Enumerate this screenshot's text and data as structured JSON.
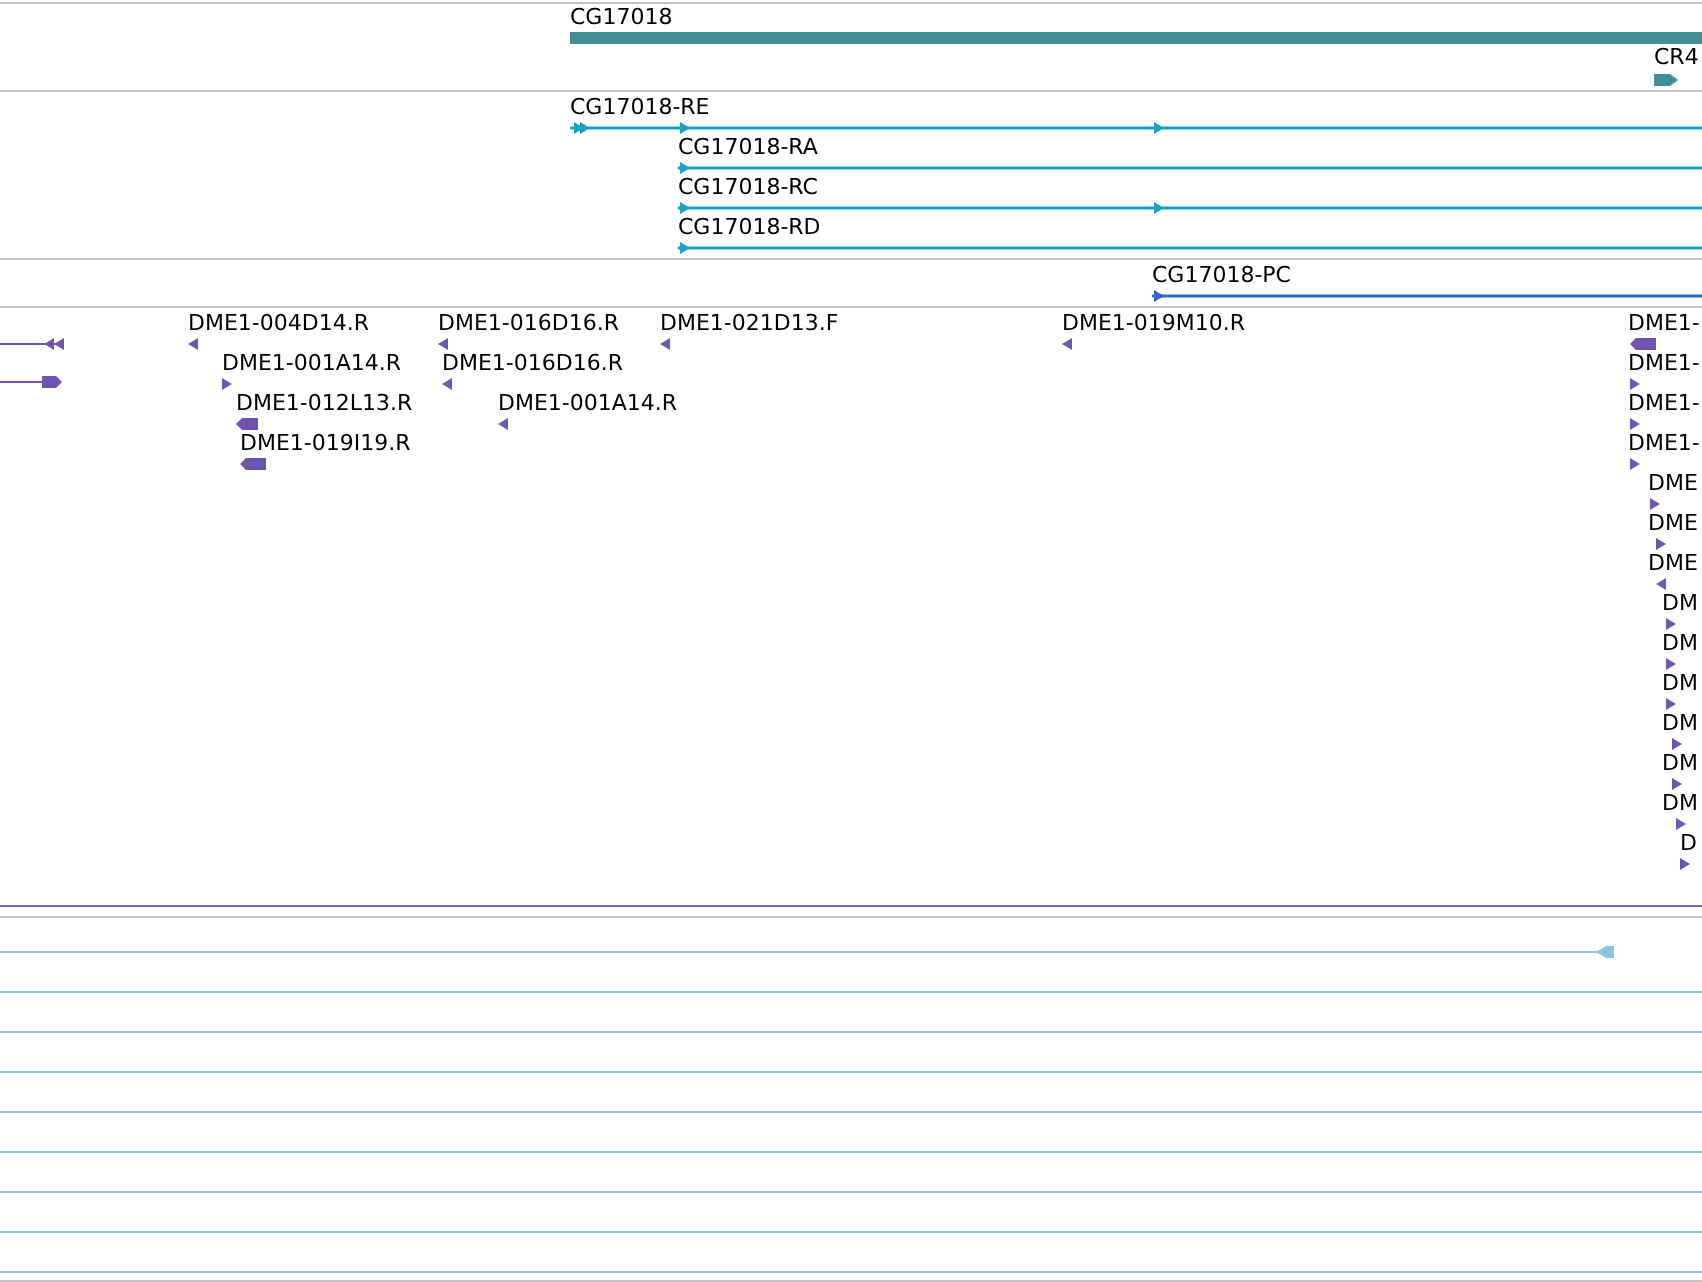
{
  "gene_track": {
    "features": [
      {
        "label": "CG17018",
        "kind": "bar"
      },
      {
        "label": "CR4",
        "kind": "arrow"
      }
    ]
  },
  "transcript_track": {
    "features": [
      {
        "label": "CG17018-RE"
      },
      {
        "label": "CG17018-RA"
      },
      {
        "label": "CG17018-RC"
      },
      {
        "label": "CG17018-RD"
      }
    ]
  },
  "protein_track": {
    "features": [
      {
        "label": "CG17018-PC"
      }
    ]
  },
  "read_track": {
    "reads": [
      {
        "label": "DME1-004D14.R",
        "reverse": true
      },
      {
        "label": "DME1-001A14.R",
        "reverse": false
      },
      {
        "label": "DME1-012L13.R",
        "reverse": true
      },
      {
        "label": "DME1-019I19.R",
        "reverse": true
      },
      {
        "label": "DME1-016D16.R",
        "reverse": true
      },
      {
        "label": "DME1-016D16.R",
        "reverse": true
      },
      {
        "label": "DME1-001A14.R",
        "reverse": true
      },
      {
        "label": "DME1-021D13.F",
        "reverse": true
      },
      {
        "label": "DME1-019M10.R",
        "reverse": true
      },
      {
        "label": "DME1-",
        "reverse": true
      },
      {
        "label": "DME1-",
        "reverse": false
      },
      {
        "label": "DME1-",
        "reverse": false
      },
      {
        "label": "DME1-",
        "reverse": false
      },
      {
        "label": "DME",
        "reverse": false
      },
      {
        "label": "DME",
        "reverse": false
      },
      {
        "label": "DME",
        "reverse": true
      },
      {
        "label": "DM",
        "reverse": false
      },
      {
        "label": "DM",
        "reverse": false
      },
      {
        "label": "DM",
        "reverse": false
      },
      {
        "label": "DM",
        "reverse": false
      },
      {
        "label": "DM",
        "reverse": false
      },
      {
        "label": "DM",
        "reverse": false
      },
      {
        "label": "D",
        "reverse": false
      }
    ]
  }
}
